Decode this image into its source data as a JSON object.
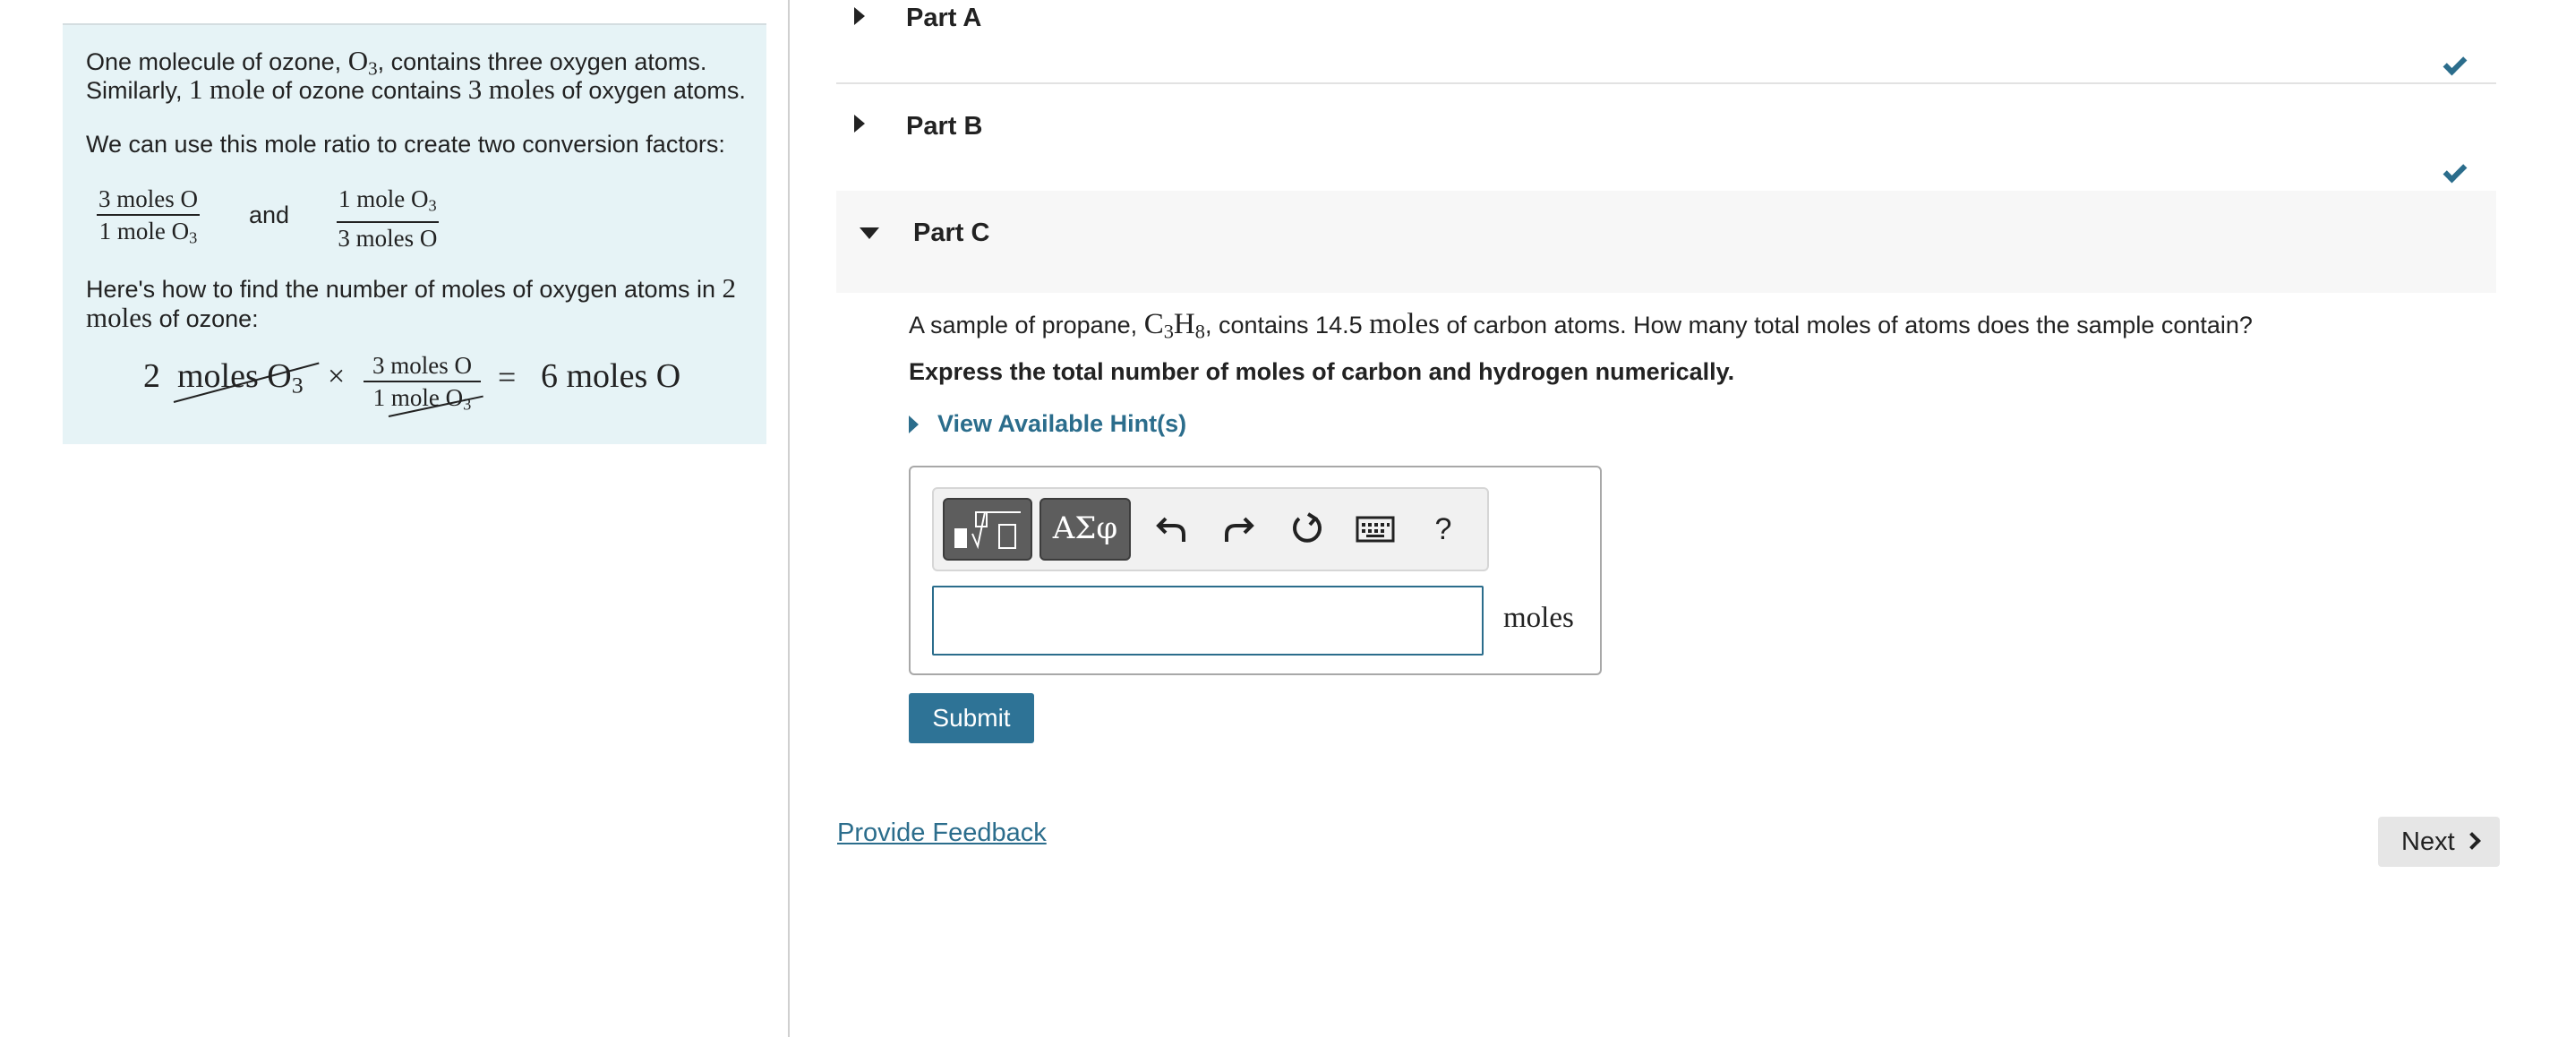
{
  "intro": {
    "p1_a": "One molecule of ozone,",
    "p1_math_o3": "O",
    "p1_sub3": "3",
    "p1_b": ", contains three oxygen atoms.",
    "p2_a": "Similarly,",
    "p2_one": "1",
    "p2_mole": "mole",
    "p2_b": "of ozone contains",
    "p2_three": "3",
    "p2_moles": "moles",
    "p2_c": "of oxygen atoms.",
    "p3": "We can use this mole ratio to create two conversion factors:",
    "factor1_num": "3 moles O",
    "factor1_den_text": "1 mole O",
    "factor1_den_sub": "3",
    "and": "and",
    "factor2_num_text": "1 mole O",
    "factor2_num_sub": "3",
    "factor2_den": "3 moles O",
    "p4_a": "Here's how to find the number of moles of oxygen atoms in",
    "p4_two": "2",
    "p4_moles": "moles",
    "p4_b": "of ozone:",
    "calc_coef": "2",
    "calc_units": "moles O",
    "calc_units_sub": "3",
    "calc_times": "×",
    "calc_frac_num": "3 moles O",
    "calc_frac_den_one": "1",
    "calc_frac_den_units": "mole O",
    "calc_frac_den_sub": "3",
    "calc_eq": "=",
    "calc_result": "6 moles O"
  },
  "parts": {
    "a": {
      "title": "Part A",
      "completed": true
    },
    "b": {
      "title": "Part B",
      "completed": true
    },
    "c": {
      "title": "Part C",
      "expanded": true
    }
  },
  "question": {
    "text_a": "A sample of propane,",
    "formula_c": "C",
    "formula_c_sub": "3",
    "formula_h": "H",
    "formula_h_sub": "8",
    "text_b": ", contains 14.5",
    "moles_word": "moles",
    "text_c": "of carbon atoms. How many total moles of atoms does the sample contain?",
    "instruction": "Express the total number of moles of carbon and hydrogen numerically.",
    "hint_label": "View Available Hint(s)"
  },
  "answer": {
    "toolbar": {
      "templates_icon": "template-icon",
      "symbols_label": "ΑΣφ",
      "undo_icon": "undo-icon",
      "redo_icon": "redo-icon",
      "reset_icon": "reset-icon",
      "keyboard_icon": "keyboard-icon",
      "help_label": "?"
    },
    "input_value": "",
    "unit": "moles"
  },
  "actions": {
    "submit_label": "Submit",
    "feedback_label": "Provide Feedback",
    "next_label": "Next"
  },
  "colors": {
    "accent": "#2b6d8c",
    "intro_bg": "#e6f3f6",
    "submit_bg": "#2e7396"
  }
}
